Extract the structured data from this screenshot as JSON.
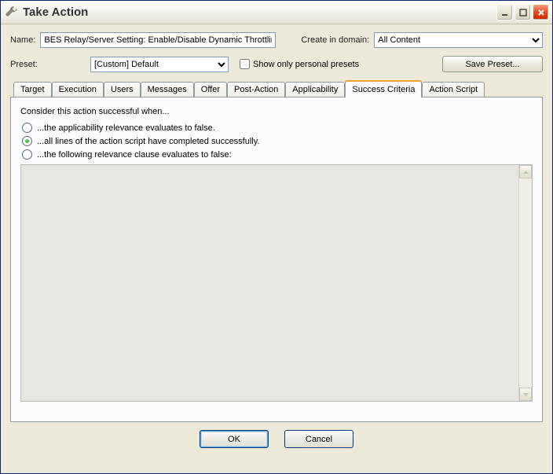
{
  "window": {
    "title": "Take Action",
    "icon": "wrench-icon"
  },
  "name": {
    "label": "Name:",
    "value": "BES Relay/Server Setting: Enable/Disable Dynamic Throttling"
  },
  "domain": {
    "label": "Create in domain:",
    "selected": "All Content"
  },
  "preset": {
    "label": "Preset:",
    "selected": "[Custom] Default",
    "show_personal_label": "Show only personal presets",
    "show_personal_checked": false,
    "save_button": "Save Preset..."
  },
  "tabs": [
    {
      "label": "Target",
      "active": false
    },
    {
      "label": "Execution",
      "active": false
    },
    {
      "label": "Users",
      "active": false
    },
    {
      "label": "Messages",
      "active": false
    },
    {
      "label": "Offer",
      "active": false
    },
    {
      "label": "Post-Action",
      "active": false
    },
    {
      "label": "Applicability",
      "active": false
    },
    {
      "label": "Success Criteria",
      "active": true
    },
    {
      "label": "Action Script",
      "active": false
    }
  ],
  "success": {
    "prompt": "Consider this action successful when...",
    "options": [
      {
        "label": "...the applicability relevance evaluates to false.",
        "selected": false
      },
      {
        "label": "...all lines of the action script have completed successfully.",
        "selected": true
      },
      {
        "label": "...the following relevance clause evaluates to false:",
        "selected": false
      }
    ],
    "relevance_text": ""
  },
  "buttons": {
    "ok": "OK",
    "cancel": "Cancel"
  }
}
